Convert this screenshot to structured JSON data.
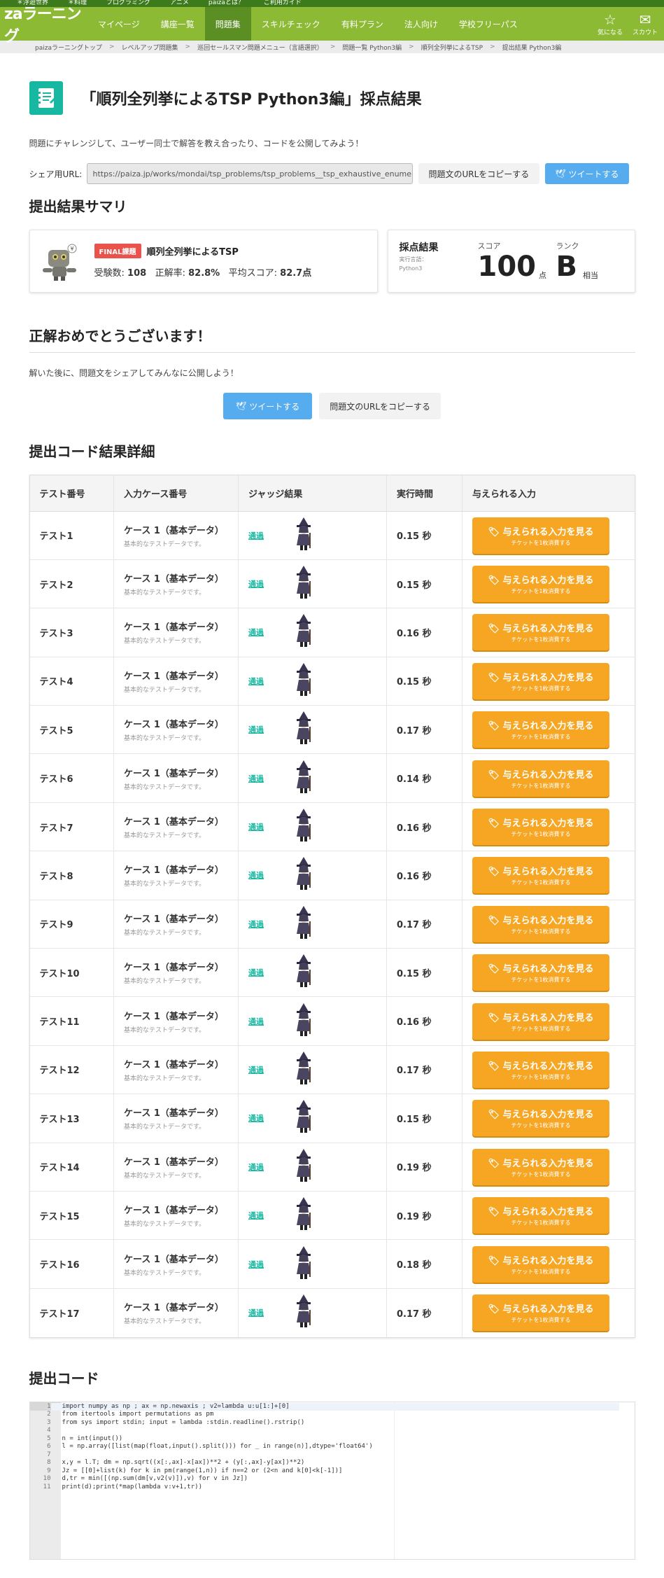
{
  "topstrip": [
    "＊浮遊世界",
    "＊料理",
    "プログラミング",
    "アニメ",
    "paizaとは？",
    "ご利用ガイド"
  ],
  "nav": {
    "logo": "zaラーニング",
    "items": [
      {
        "label": "マイページ",
        "active": false
      },
      {
        "label": "講座一覧",
        "active": false
      },
      {
        "label": "問題集",
        "active": true
      },
      {
        "label": "スキルチェック",
        "active": false
      },
      {
        "label": "有料プラン",
        "active": false
      },
      {
        "label": "法人向け",
        "active": false
      },
      {
        "label": "学校フリーパス",
        "active": false
      }
    ],
    "favorite_label": "気になる",
    "scout_label": "スカウト"
  },
  "breadcrumb": [
    "paizaラーニングトップ",
    "レベルアップ問題集",
    "巡回セールスマン問題メニュー（言語選択）",
    "問題一覧 Python3編",
    "順列全列挙によるTSP",
    "提出結果 Python3編"
  ],
  "header": {
    "title": "「順列全列挙によるTSP Python3編」採点結果",
    "lead": "問題にチャレンジして、ユーザー同士で解答を教え合ったり、コードを公開してみよう！"
  },
  "share": {
    "label": "シェア用URL:",
    "url": "https://paiza.jp/works/mondai/tsp_problems/tsp_problems__tsp_exhaustive_enume",
    "copy_label": "問題文のURLをコピーする",
    "tweet_label": "ツイートする"
  },
  "summary": {
    "heading": "提出結果サマリ",
    "badge": "FINAL課題",
    "problem_title": "順列全列挙によるTSP",
    "examinees_label": "受験数:",
    "examinees": "108",
    "accuracy_label": "正解率:",
    "accuracy": "82.8%",
    "avg_label": "平均スコア:",
    "avg": "82.7点",
    "result_label": "採点結果",
    "lang_label": "実行言語：",
    "lang": "Python3",
    "score_label": "スコア",
    "score": "100",
    "score_unit": "点",
    "rank_label": "ランク",
    "rank": "B",
    "rank_unit": "相当"
  },
  "congrats": {
    "title": "正解おめでとうございます！",
    "lead": "解いた後に、問題文をシェアしてみんなに公開しよう！",
    "tweet_label": "ツイートする",
    "copy_label": "問題文のURLをコピーする"
  },
  "details": {
    "heading": "提出コード結果詳細",
    "columns": [
      "テスト番号",
      "入力ケース番号",
      "ジャッジ結果",
      "実行時間",
      "与えられる入力"
    ],
    "case_name": "ケース 1（基本データ）",
    "case_desc": "基本的なテストデータです。",
    "judge": "通過",
    "input_btn": "与えられる入力を見る",
    "input_btn_sub": "チケットを1枚消費する",
    "rows": [
      {
        "test": "テスト1",
        "time": "0.15 秒"
      },
      {
        "test": "テスト2",
        "time": "0.15 秒"
      },
      {
        "test": "テスト3",
        "time": "0.16 秒"
      },
      {
        "test": "テスト4",
        "time": "0.15 秒"
      },
      {
        "test": "テスト5",
        "time": "0.17 秒"
      },
      {
        "test": "テスト6",
        "time": "0.14 秒"
      },
      {
        "test": "テスト7",
        "time": "0.16 秒"
      },
      {
        "test": "テスト8",
        "time": "0.16 秒"
      },
      {
        "test": "テスト9",
        "time": "0.17 秒"
      },
      {
        "test": "テスト10",
        "time": "0.15 秒"
      },
      {
        "test": "テスト11",
        "time": "0.16 秒"
      },
      {
        "test": "テスト12",
        "time": "0.17 秒"
      },
      {
        "test": "テスト13",
        "time": "0.15 秒"
      },
      {
        "test": "テスト14",
        "time": "0.19 秒"
      },
      {
        "test": "テスト15",
        "time": "0.19 秒"
      },
      {
        "test": "テスト16",
        "time": "0.18 秒"
      },
      {
        "test": "テスト17",
        "time": "0.17 秒"
      }
    ]
  },
  "code": {
    "heading": "提出コード",
    "lines": [
      "import numpy as np ; ax = np.newaxis ; v2=lambda u:u[1:]+[0]",
      "from itertools import permutations as pm",
      "from sys import stdin; input = lambda :stdin.readline().rstrip()",
      "",
      "n = int(input())",
      "l = np.array([list(map(float,input().split())) for _ in range(n)],dtype='float64')",
      "",
      "x,y = l.T; dm = np.sqrt((x[:,ax]-x[ax])**2 + (y[:,ax]-y[ax])**2)",
      "Jz = [[0]+list(k) for k in pm(range(1,n)) if n==2 or (2<n and k[0]<k[-1])]",
      "d,tr = min([(np.sum(dm[v,v2(v)]),v) for v in Jz])",
      "print(d);print(*map(lambda v:v+1,tr))"
    ]
  }
}
